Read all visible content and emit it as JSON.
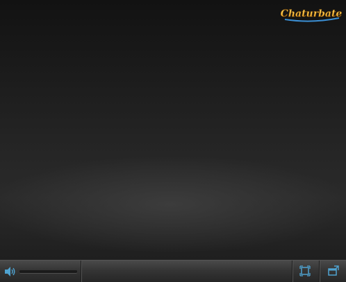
{
  "player": {
    "logo": {
      "text": "Chaturbate",
      "icon": "chaturbate-logo"
    },
    "controls": {
      "volume_icon": "speaker-icon",
      "volume_level": 1.0,
      "fit_icon": "fit-screen-icon",
      "popout_icon": "popout-window-icon",
      "icon_color": "#4fa3d1"
    }
  }
}
